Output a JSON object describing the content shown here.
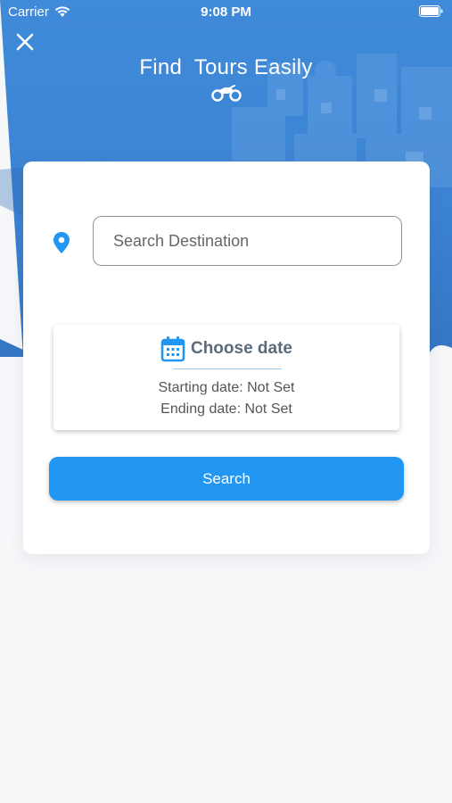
{
  "status_bar": {
    "carrier": "Carrier",
    "time": "9:08 PM"
  },
  "header": {
    "title": "Find  Tours Easily",
    "close_icon": "close-icon",
    "logo_icon": "motorcycle-icon"
  },
  "search": {
    "placeholder": "Search Destination",
    "value": "",
    "location_icon": "map-pin-icon"
  },
  "date_picker": {
    "label": "Choose date",
    "icon": "calendar-icon",
    "starting_date": "Starting date: Not Set",
    "ending_date": "Ending date: Not Set"
  },
  "search_button": {
    "label": "Search"
  },
  "colors": {
    "accent": "#2196f3",
    "hero": "#3b84d6",
    "background": "#f6f7f9"
  }
}
